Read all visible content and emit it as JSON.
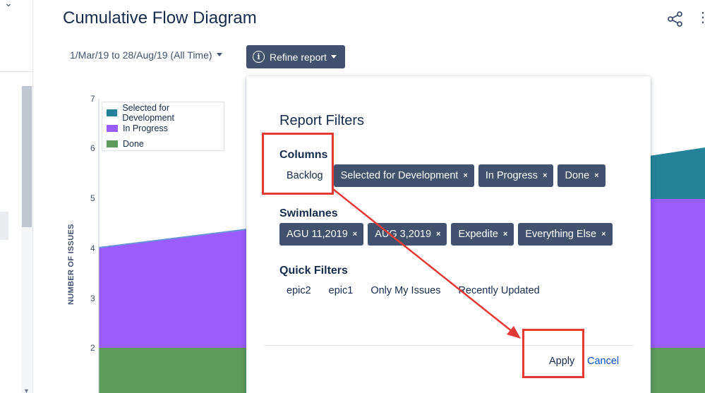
{
  "page": {
    "title": "Cumulative Flow Diagram",
    "date_range": "1/Mar/19 to 28/Aug/19 (All Time)",
    "refine_label": "Refine report"
  },
  "chart": {
    "ylabel": "NUMBER OF ISSUES",
    "y_ticks": [
      "2",
      "3",
      "4",
      "5",
      "6",
      "7"
    ],
    "legend": [
      {
        "label": "Selected for Development",
        "color": "#248399"
      },
      {
        "label": "In Progress",
        "color": "#9a5cfc"
      },
      {
        "label": "Done",
        "color": "#5c9b5a"
      }
    ]
  },
  "chart_data": {
    "type": "area",
    "ylabel": "NUMBER OF ISSUES",
    "ylim": [
      1.5,
      7
    ],
    "series": [
      {
        "name": "Done",
        "color": "#5c9b5a"
      },
      {
        "name": "In Progress",
        "color": "#9a5cfc"
      },
      {
        "name": "Selected for Development",
        "color": "#248399"
      }
    ],
    "legend_position": "top-left",
    "grid": false
  },
  "dialog": {
    "title": "Report Filters",
    "columns_heading": "Columns",
    "columns": [
      {
        "label": "Backlog",
        "selected": false
      },
      {
        "label": "Selected for Development",
        "selected": true
      },
      {
        "label": "In Progress",
        "selected": true
      },
      {
        "label": "Done",
        "selected": true
      }
    ],
    "swimlanes_heading": "Swimlanes",
    "swimlanes": [
      {
        "label": "AGU 11,2019"
      },
      {
        "label": "AUG 3,2019"
      },
      {
        "label": "Expedite"
      },
      {
        "label": "Everything Else"
      }
    ],
    "quick_filters_heading": "Quick Filters",
    "quick_filters": [
      "epic2",
      "epic1",
      "Only My Issues",
      "Recently Updated"
    ],
    "apply_label": "Apply",
    "cancel_label": "Cancel"
  },
  "icons": {
    "share": "share-icon",
    "info": "info-icon",
    "remove": "×"
  },
  "colors": {
    "chip_bg": "#42526e",
    "annotation": "#e53935",
    "link": "#0052cc"
  }
}
